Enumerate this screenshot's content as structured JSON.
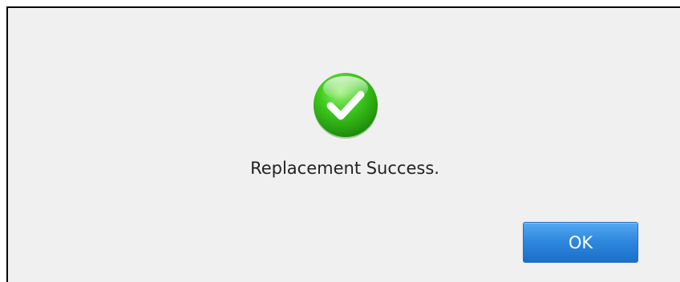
{
  "dialog": {
    "icon": "success-checkmark-icon",
    "icon_color": "#3bbf1a",
    "message": "Replacement Success.",
    "ok_label": "OK",
    "accent_color": "#2f89df"
  }
}
